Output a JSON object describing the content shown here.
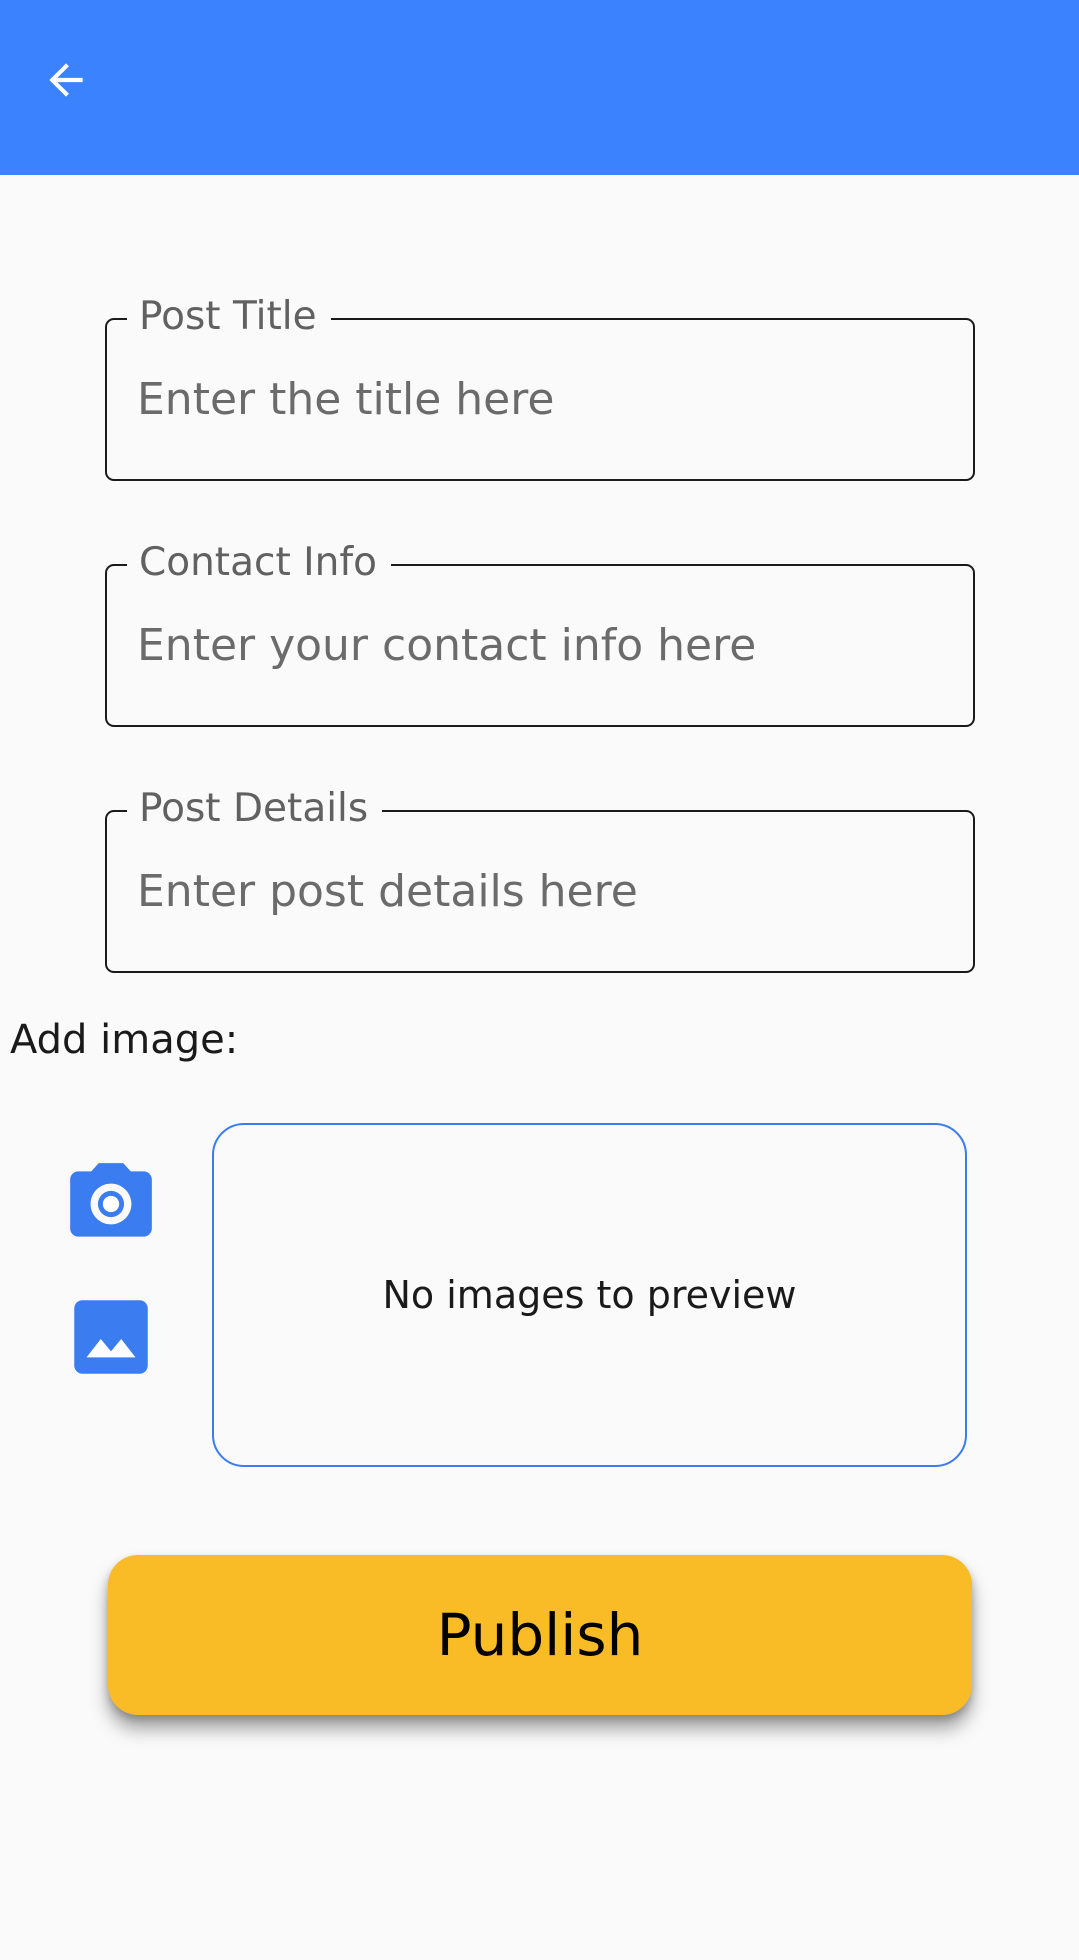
{
  "appbar": {
    "back_icon": "arrow-left-icon",
    "color": "#3b82ff"
  },
  "form": {
    "title": {
      "label": "Post Title",
      "placeholder": "Enter the title here",
      "value": ""
    },
    "contact": {
      "label": "Contact Info",
      "placeholder": "Enter your contact info here",
      "value": ""
    },
    "details": {
      "label": "Post Details",
      "placeholder": "Enter post details here",
      "value": ""
    }
  },
  "images": {
    "label": "Add image:",
    "camera_icon": "camera-icon",
    "gallery_icon": "image-icon",
    "preview_empty_text": "No images to preview",
    "accent_color": "#3b7cf0"
  },
  "publish": {
    "label": "Publish",
    "color": "#f9bb26"
  }
}
